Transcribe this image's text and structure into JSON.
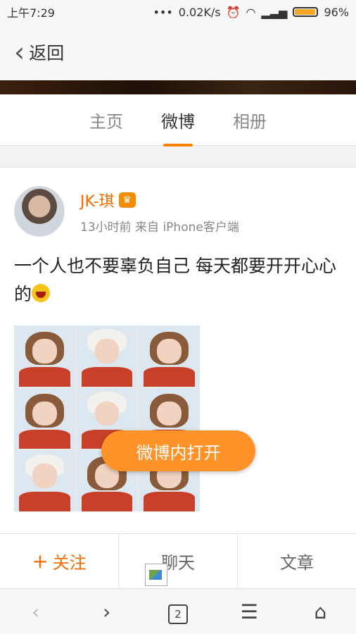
{
  "status_bar": {
    "time": "上午7:29",
    "speed": "0.02K/s",
    "battery": "96%"
  },
  "nav": {
    "back_label": "返回"
  },
  "tabs": [
    {
      "label": "主页"
    },
    {
      "label": "微博"
    },
    {
      "label": "相册"
    }
  ],
  "post": {
    "author": "JK-琪",
    "meta": "13小时前 来自 iPhone客户端",
    "text": "一个人也不要辜负自己 每天都要开开心心的",
    "photo_count": 9
  },
  "open_in_app": "微博内打开",
  "actions": {
    "follow_plus": "+",
    "follow": "关注",
    "chat": "聊天",
    "article": "文章"
  },
  "toolbar": {
    "tab_count": "2"
  },
  "colors": {
    "accent": "#ff8200",
    "follow": "#f06b00",
    "button": "#ff9228"
  }
}
